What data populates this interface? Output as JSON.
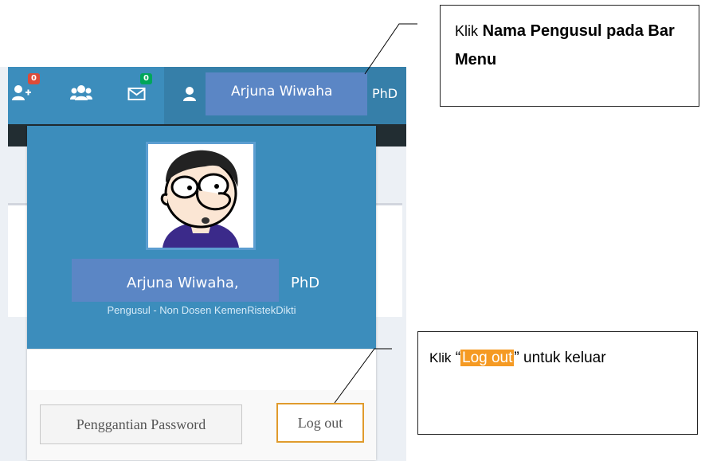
{
  "navbar": {
    "add_user_badge": "0",
    "messages_badge": "0",
    "user_name": "Arjuna Wiwaha",
    "user_suffix": "PhD"
  },
  "dropdown": {
    "name": "Arjuna Wiwaha,",
    "suffix": "PhD",
    "role": "Pengusul - Non Dosen KemenRistekDikti",
    "password_button": "Penggantian Password",
    "logout_button": "Log out"
  },
  "callouts": {
    "top_prefix": "Klik",
    "top_bold": "Nama Pengusul pada Bar Menu",
    "bottom_prefix": "Klik",
    "bottom_open_quote": "“",
    "bottom_chip": "Log out",
    "bottom_close_quote": "”",
    "bottom_suffix": "untuk keluar"
  },
  "icons": {
    "add_user": "user-plus-icon",
    "group": "users-icon",
    "messages": "envelope-icon",
    "user": "user-icon",
    "avatar": "cartoon-avatar"
  },
  "colors": {
    "navbar": "#3c8dbc",
    "highlight": "#5b86c5",
    "accent_orange": "#f59a23"
  }
}
